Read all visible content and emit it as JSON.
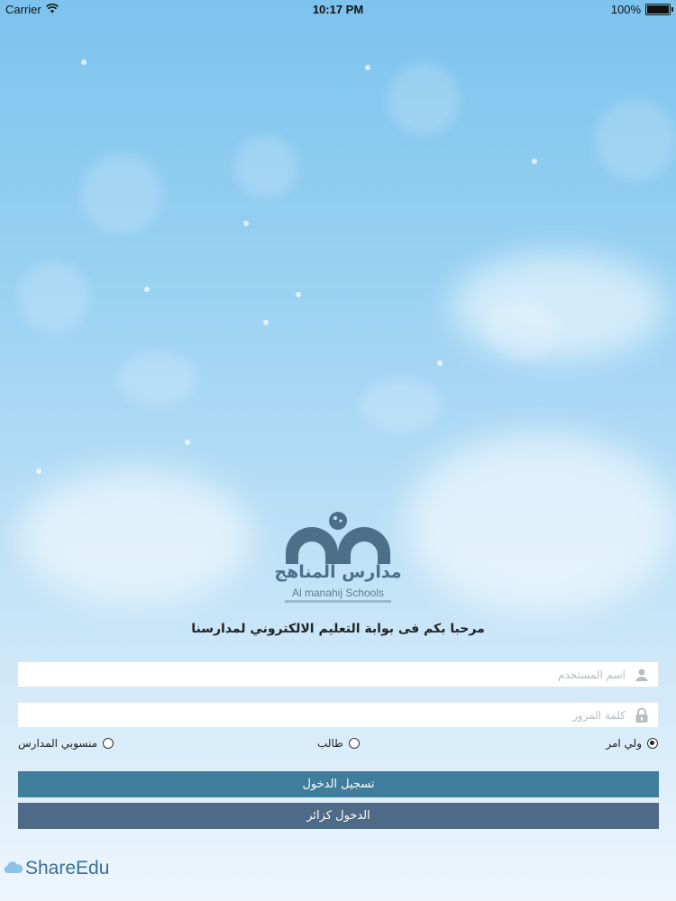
{
  "status_bar": {
    "carrier": "Carrier",
    "time": "10:17 PM",
    "battery_text": "100%",
    "battery_level": 1.0
  },
  "logo": {
    "name_ar": "مدارس المناهج",
    "name_en": "Al manahij Schools",
    "color": "#4d6f88"
  },
  "welcome_text": "مرحبا بكم فى بوابة التعليم الالكتروني لمدارسنا",
  "form": {
    "username_placeholder": "اسم المستخدم",
    "username_value": "",
    "password_placeholder": "كلمة المرور",
    "password_value": "",
    "roles": [
      {
        "label": "ولي امر",
        "selected": true
      },
      {
        "label": "طالب",
        "selected": false
      },
      {
        "label": "منسوبي المدارس",
        "selected": false
      }
    ]
  },
  "buttons": {
    "login": "تسجيل الدخول",
    "visitor": "الدخول كزائر"
  },
  "footer": {
    "brand": "ShareEdu"
  },
  "colors": {
    "login_button": "#3e7e9c",
    "visitor_button": "#4e6a86",
    "sky": "#7cc3ee"
  }
}
